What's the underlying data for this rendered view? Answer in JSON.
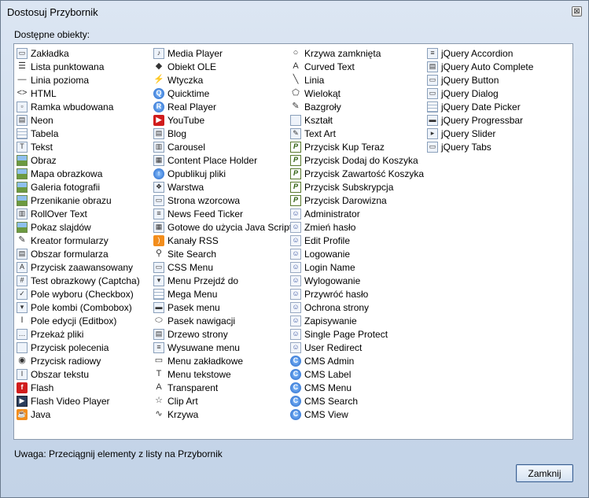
{
  "window": {
    "title": "Dostosuj Przybornik"
  },
  "list_label": "Dostępne obiekty:",
  "columns": [
    [
      {
        "label": "Zakładka",
        "icon": "tab-icon",
        "type": "box",
        "glyph": "▭"
      },
      {
        "label": "Lista punktowana",
        "icon": "bullet-list-icon",
        "type": "plain",
        "glyph": "☰"
      },
      {
        "label": "Linia pozioma",
        "icon": "horizontal-line-icon",
        "type": "plain",
        "glyph": "—"
      },
      {
        "label": "HTML",
        "icon": "html-icon",
        "type": "plain",
        "glyph": "<>"
      },
      {
        "label": "Ramka wbudowana",
        "icon": "iframe-icon",
        "type": "box",
        "glyph": "▫"
      },
      {
        "label": "Neon",
        "icon": "neon-icon",
        "type": "box",
        "glyph": "▤"
      },
      {
        "label": "Tabela",
        "icon": "table-icon",
        "type": "grid",
        "glyph": ""
      },
      {
        "label": "Tekst",
        "icon": "text-icon",
        "type": "box",
        "glyph": "T"
      },
      {
        "label": "Obraz",
        "icon": "image-icon",
        "type": "pic",
        "glyph": ""
      },
      {
        "label": "Mapa obrazkowa",
        "icon": "image-map-icon",
        "type": "pic",
        "glyph": ""
      },
      {
        "label": "Galeria fotografii",
        "icon": "photo-gallery-icon",
        "type": "pic",
        "glyph": ""
      },
      {
        "label": "Przenikanie obrazu",
        "icon": "image-fade-icon",
        "type": "pic",
        "glyph": ""
      },
      {
        "label": "RollOver Text",
        "icon": "rollover-text-icon",
        "type": "box",
        "glyph": "▥"
      },
      {
        "label": "Pokaz slajdów",
        "icon": "slideshow-icon",
        "type": "pic",
        "glyph": ""
      },
      {
        "label": "Kreator formularzy",
        "icon": "form-wizard-icon",
        "type": "plain",
        "glyph": "✎"
      },
      {
        "label": "Obszar formularza",
        "icon": "form-area-icon",
        "type": "box",
        "glyph": "▤"
      },
      {
        "label": "Przycisk zaawansowany",
        "icon": "advanced-button-icon",
        "type": "box",
        "glyph": "A"
      },
      {
        "label": "Test obrazkowy (Captcha)",
        "icon": "captcha-icon",
        "type": "box",
        "glyph": "#"
      },
      {
        "label": "Pole wyboru (Checkbox)",
        "icon": "checkbox-icon",
        "type": "box",
        "glyph": "✓"
      },
      {
        "label": "Pole kombi (Combobox)",
        "icon": "combobox-icon",
        "type": "box",
        "glyph": "▾"
      },
      {
        "label": "Pole edycji (Editbox)",
        "icon": "editbox-icon",
        "type": "plain",
        "glyph": "I"
      },
      {
        "label": "Przekaż pliki",
        "icon": "file-upload-icon",
        "type": "box",
        "glyph": "…"
      },
      {
        "label": "Przycisk polecenia",
        "icon": "command-button-icon",
        "type": "box",
        "glyph": ""
      },
      {
        "label": "Przycisk radiowy",
        "icon": "radio-button-icon",
        "type": "plain",
        "glyph": "◉"
      },
      {
        "label": "Obszar tekstu",
        "icon": "text-area-icon",
        "type": "box",
        "glyph": "I"
      },
      {
        "label": "Flash",
        "icon": "flash-icon",
        "type": "red",
        "glyph": "f"
      },
      {
        "label": "Flash Video Player",
        "icon": "flash-video-icon",
        "type": "dark",
        "glyph": "▶"
      },
      {
        "label": "Java",
        "icon": "java-icon",
        "type": "orange",
        "glyph": "☕"
      }
    ],
    [
      {
        "label": "Media Player",
        "icon": "media-player-icon",
        "type": "box",
        "glyph": "♪"
      },
      {
        "label": "Obiekt OLE",
        "icon": "ole-object-icon",
        "type": "plain",
        "glyph": "◆"
      },
      {
        "label": "Wtyczka",
        "icon": "plugin-icon",
        "type": "plain",
        "glyph": "⚡"
      },
      {
        "label": "Quicktime",
        "icon": "quicktime-icon",
        "type": "blue",
        "glyph": "Q"
      },
      {
        "label": "Real Player",
        "icon": "real-player-icon",
        "type": "blue",
        "glyph": "R"
      },
      {
        "label": "YouTube",
        "icon": "youtube-icon",
        "type": "red",
        "glyph": "▶"
      },
      {
        "label": "Blog",
        "icon": "blog-icon",
        "type": "box",
        "glyph": "▤"
      },
      {
        "label": "Carousel",
        "icon": "carousel-icon",
        "type": "box",
        "glyph": "▥"
      },
      {
        "label": "Content Place Holder",
        "icon": "content-placeholder-icon",
        "type": "box",
        "glyph": "▦"
      },
      {
        "label": "Opublikuj pliki",
        "icon": "publish-files-icon",
        "type": "blue",
        "glyph": "↑"
      },
      {
        "label": "Warstwa",
        "icon": "layer-icon",
        "type": "box",
        "glyph": "❖"
      },
      {
        "label": "Strona wzorcowa",
        "icon": "master-page-icon",
        "type": "box",
        "glyph": "▭"
      },
      {
        "label": "News Feed Ticker",
        "icon": "news-ticker-icon",
        "type": "box",
        "glyph": "≡"
      },
      {
        "label": "Gotowe do użycia Java Scripts",
        "icon": "javascript-icon",
        "type": "box",
        "glyph": "▦"
      },
      {
        "label": "Kanały RSS",
        "icon": "rss-icon",
        "type": "orange",
        "glyph": ")"
      },
      {
        "label": "Site Search",
        "icon": "site-search-icon",
        "type": "plain",
        "glyph": "⚲"
      },
      {
        "label": "CSS Menu",
        "icon": "css-menu-icon",
        "type": "box",
        "glyph": "▭"
      },
      {
        "label": "Menu Przejdź do",
        "icon": "goto-menu-icon",
        "type": "box",
        "glyph": "▾"
      },
      {
        "label": "Mega Menu",
        "icon": "mega-menu-icon",
        "type": "grid",
        "glyph": ""
      },
      {
        "label": "Pasek menu",
        "icon": "menu-bar-icon",
        "type": "box",
        "glyph": "▬"
      },
      {
        "label": "Pasek nawigacji",
        "icon": "nav-bar-icon",
        "type": "plain",
        "glyph": "⬭"
      },
      {
        "label": "Drzewo strony",
        "icon": "site-tree-icon",
        "type": "box",
        "glyph": "▤"
      },
      {
        "label": "Wysuwane menu",
        "icon": "slide-menu-icon",
        "type": "box",
        "glyph": "≡"
      },
      {
        "label": "Menu zakładkowe",
        "icon": "tab-menu-icon",
        "type": "plain",
        "glyph": "▭"
      },
      {
        "label": "Menu tekstowe",
        "icon": "text-menu-icon",
        "type": "plain",
        "glyph": "T"
      },
      {
        "label": "Transparent",
        "icon": "transparent-icon",
        "type": "plain",
        "glyph": "A"
      },
      {
        "label": "Clip Art",
        "icon": "clip-art-icon",
        "type": "plain",
        "glyph": "☆"
      },
      {
        "label": "Krzywa",
        "icon": "curve-icon",
        "type": "plain",
        "glyph": "∿"
      }
    ],
    [
      {
        "label": "Krzywa zamknięta",
        "icon": "closed-curve-icon",
        "type": "plain",
        "glyph": "○"
      },
      {
        "label": "Curved Text",
        "icon": "curved-text-icon",
        "type": "plain",
        "glyph": "A"
      },
      {
        "label": "Linia",
        "icon": "line-icon",
        "type": "plain",
        "glyph": "╲"
      },
      {
        "label": "Wielokąt",
        "icon": "polygon-icon",
        "type": "plain",
        "glyph": "⬠"
      },
      {
        "label": "Bazgroły",
        "icon": "scribble-icon",
        "type": "plain",
        "glyph": "✎"
      },
      {
        "label": "Kształt",
        "icon": "shape-icon",
        "type": "box",
        "glyph": ""
      },
      {
        "label": "Text Art",
        "icon": "text-art-icon",
        "type": "box",
        "glyph": "✎"
      },
      {
        "label": "Przycisk Kup Teraz",
        "icon": "paypal-buy-now-icon",
        "type": "green",
        "glyph": "P"
      },
      {
        "label": "Przycisk Dodaj do Koszyka",
        "icon": "paypal-add-to-cart-icon",
        "type": "green",
        "glyph": "P"
      },
      {
        "label": "Przycisk Zawartość Koszyka",
        "icon": "paypal-view-cart-icon",
        "type": "green",
        "glyph": "P"
      },
      {
        "label": "Przycisk Subskrypcja",
        "icon": "paypal-subscribe-icon",
        "type": "green",
        "glyph": "P"
      },
      {
        "label": "Przycisk Darowizna",
        "icon": "paypal-donate-icon",
        "type": "green",
        "glyph": "P"
      },
      {
        "label": "Administrator",
        "icon": "administrator-icon",
        "type": "person",
        "glyph": "☺"
      },
      {
        "label": "Zmień hasło",
        "icon": "change-password-icon",
        "type": "person",
        "glyph": "☺"
      },
      {
        "label": "Edit Profile",
        "icon": "edit-profile-icon",
        "type": "person",
        "glyph": "☺"
      },
      {
        "label": "Logowanie",
        "icon": "login-icon",
        "type": "person",
        "glyph": "☺"
      },
      {
        "label": "Login Name",
        "icon": "login-name-icon",
        "type": "person",
        "glyph": "☺"
      },
      {
        "label": "Wylogowanie",
        "icon": "logout-icon",
        "type": "person",
        "glyph": "☺"
      },
      {
        "label": "Przywróć hasło",
        "icon": "recover-password-icon",
        "type": "person",
        "glyph": "☺"
      },
      {
        "label": "Ochrona strony",
        "icon": "page-protection-icon",
        "type": "person",
        "glyph": "☺"
      },
      {
        "label": "Zapisywanie",
        "icon": "signup-icon",
        "type": "person",
        "glyph": "☺"
      },
      {
        "label": "Single Page Protect",
        "icon": "single-page-protect-icon",
        "type": "person",
        "glyph": "☺"
      },
      {
        "label": "User Redirect",
        "icon": "user-redirect-icon",
        "type": "person",
        "glyph": "☺"
      },
      {
        "label": "CMS Admin",
        "icon": "cms-admin-icon",
        "type": "blue",
        "glyph": "C"
      },
      {
        "label": "CMS Label",
        "icon": "cms-label-icon",
        "type": "blue",
        "glyph": "C"
      },
      {
        "label": "CMS Menu",
        "icon": "cms-menu-icon",
        "type": "blue",
        "glyph": "C"
      },
      {
        "label": "CMS Search",
        "icon": "cms-search-icon",
        "type": "blue",
        "glyph": "C"
      },
      {
        "label": "CMS View",
        "icon": "cms-view-icon",
        "type": "blue",
        "glyph": "C"
      }
    ],
    [
      {
        "label": "jQuery Accordion",
        "icon": "jquery-accordion-icon",
        "type": "box",
        "glyph": "≡"
      },
      {
        "label": "jQuery Auto Complete",
        "icon": "jquery-autocomplete-icon",
        "type": "box",
        "glyph": "▤"
      },
      {
        "label": "jQuery Button",
        "icon": "jquery-button-icon",
        "type": "box",
        "glyph": "▭"
      },
      {
        "label": "jQuery Dialog",
        "icon": "jquery-dialog-icon",
        "type": "box",
        "glyph": "▭"
      },
      {
        "label": "jQuery Date Picker",
        "icon": "jquery-datepicker-icon",
        "type": "grid",
        "glyph": ""
      },
      {
        "label": "jQuery Progressbar",
        "icon": "jquery-progressbar-icon",
        "type": "box",
        "glyph": "▬"
      },
      {
        "label": "jQuery Slider",
        "icon": "jquery-slider-icon",
        "type": "box",
        "glyph": "▸"
      },
      {
        "label": "jQuery Tabs",
        "icon": "jquery-tabs-icon",
        "type": "box",
        "glyph": "▭"
      }
    ]
  ],
  "hint": "Uwaga: Przeciągnij elementy z listy na Przybornik",
  "close_button": "Zamknij",
  "close_glyph": "⊠"
}
